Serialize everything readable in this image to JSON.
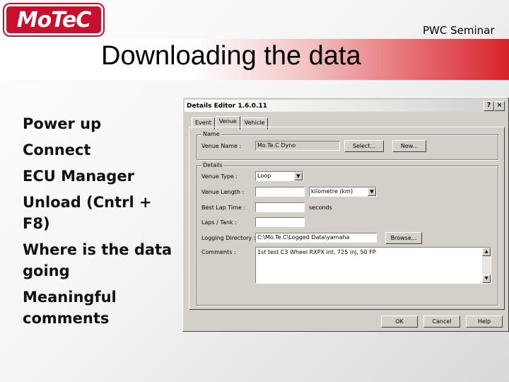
{
  "slide": {
    "logo": "MoTeC",
    "title": "Downloading the data",
    "event_tag": "PWC Seminar",
    "bullets": [
      "Power up",
      "Connect",
      "ECU Manager",
      "Unload (Cntrl + F8)",
      "Where is the data going",
      "Meaningful comments"
    ]
  },
  "dialog": {
    "title": "Details Editor 1.6.0.11",
    "help_glyph": "?",
    "close_glyph": "×",
    "tabs": [
      "Event",
      "Venue",
      "Vehicle"
    ],
    "active_tab": "Venue",
    "name_group": {
      "title": "Name",
      "venue_name_label": "Venue Name :",
      "venue_name_value": "Mo.Te.C Dyno",
      "select_button": "Select...",
      "new_button": "New..."
    },
    "details_group": {
      "title": "Details",
      "venue_type_label": "Venue Type :",
      "venue_type_value": "Loop",
      "venue_length_label": "Venue Length :",
      "venue_length_value": "",
      "length_unit_value": "kilometre (km)",
      "best_lap_label": "Best Lap Time :",
      "best_lap_value": "",
      "best_lap_unit": "seconds",
      "laps_label": "Laps / Tank :",
      "laps_value": "",
      "logging_dir_label": "Logging Directory :",
      "logging_dir_value": "C:\\Mo.Te.C\\Logged Data\\yamaha",
      "browse_button": "Browse...",
      "comments_label": "Comments :",
      "comments_value": "1st test C3 Wheel RXPX int, 725 inj, 50 FP"
    },
    "buttons": {
      "ok": "OK",
      "cancel": "Cancel",
      "help": "Help"
    }
  },
  "colors": {
    "brand_red": "#c8102e",
    "window_face": "#d4d0c8"
  }
}
